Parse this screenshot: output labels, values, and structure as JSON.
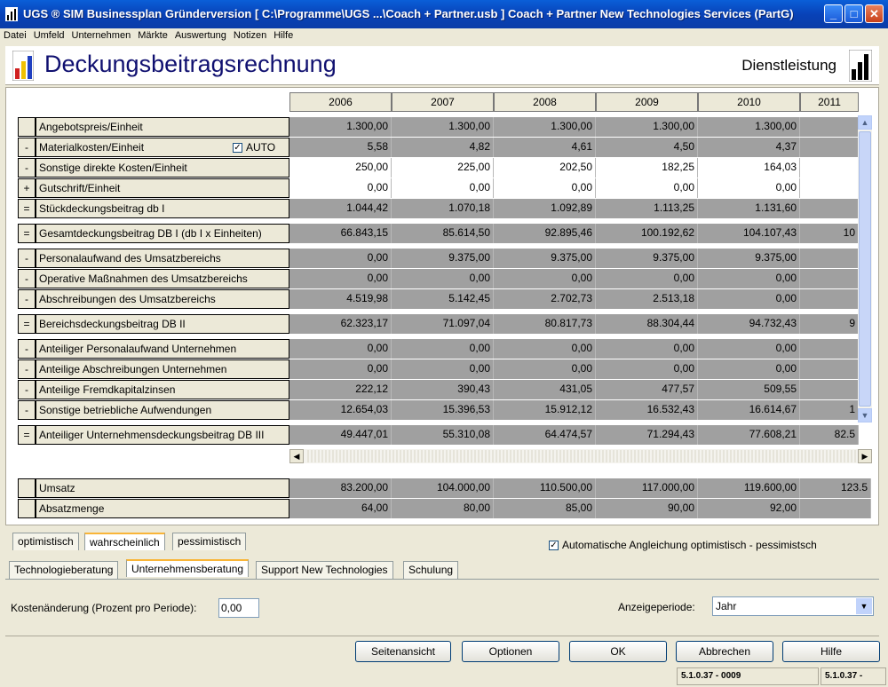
{
  "window": {
    "title": "UGS ® SIM Businessplan Gründerversion   [ C:\\Programme\\UGS ...\\Coach + Partner.usb ] Coach + Partner New Technologies Services (PartG)"
  },
  "menu": [
    "Datei",
    "Umfeld",
    "Unternehmen",
    "Märkte",
    "Auswertung",
    "Notizen",
    "Hilfe"
  ],
  "header": {
    "title": "Deckungsbeitragsrechnung",
    "category": "Dienstleistung"
  },
  "years": [
    "2006",
    "2007",
    "2008",
    "2009",
    "2010",
    "2011"
  ],
  "auto_label": "AUTO",
  "rows": [
    {
      "mark": "",
      "label": "Angebotspreis/Einheit",
      "style": "g",
      "values": [
        "1.300,00",
        "1.300,00",
        "1.300,00",
        "1.300,00",
        "1.300,00",
        ""
      ]
    },
    {
      "mark": "-",
      "label": "Materialkosten/Einheit",
      "style": "g",
      "values": [
        "5,58",
        "4,82",
        "4,61",
        "4,50",
        "4,37",
        ""
      ]
    },
    {
      "mark": "-",
      "label": "Sonstige direkte Kosten/Einheit",
      "style": "w",
      "values": [
        "250,00",
        "225,00",
        "202,50",
        "182,25",
        "164,03",
        ""
      ]
    },
    {
      "mark": "+",
      "label": "Gutschrift/Einheit",
      "style": "w",
      "values": [
        "0,00",
        "0,00",
        "0,00",
        "0,00",
        "0,00",
        ""
      ]
    },
    {
      "mark": "=",
      "label": "Stückdeckungsbeitrag db I",
      "style": "g",
      "values": [
        "1.044,42",
        "1.070,18",
        "1.092,89",
        "1.113,25",
        "1.131,60",
        ""
      ]
    },
    {
      "mark": "=",
      "label": "Gesamtdeckungsbeitrag DB I (db I x Einheiten)",
      "style": "g",
      "values": [
        "66.843,15",
        "85.614,50",
        "92.895,46",
        "100.192,62",
        "104.107,43",
        "10"
      ]
    },
    {
      "mark": "-",
      "label": "Personalaufwand des Umsatzbereichs",
      "style": "g",
      "values": [
        "0,00",
        "9.375,00",
        "9.375,00",
        "9.375,00",
        "9.375,00",
        ""
      ]
    },
    {
      "mark": "-",
      "label": "Operative Maßnahmen des Umsatzbereichs",
      "style": "g",
      "values": [
        "0,00",
        "0,00",
        "0,00",
        "0,00",
        "0,00",
        ""
      ]
    },
    {
      "mark": "-",
      "label": "Abschreibungen des Umsatzbereichs",
      "style": "g",
      "values": [
        "4.519,98",
        "5.142,45",
        "2.702,73",
        "2.513,18",
        "0,00",
        ""
      ]
    },
    {
      "mark": "=",
      "label": "Bereichsdeckungsbeitrag DB II",
      "style": "g",
      "values": [
        "62.323,17",
        "71.097,04",
        "80.817,73",
        "88.304,44",
        "94.732,43",
        "9"
      ]
    },
    {
      "mark": "-",
      "label": "Anteiliger Personalaufwand Unternehmen",
      "style": "g",
      "values": [
        "0,00",
        "0,00",
        "0,00",
        "0,00",
        "0,00",
        ""
      ]
    },
    {
      "mark": "-",
      "label": "Anteilige Abschreibungen Unternehmen",
      "style": "g",
      "values": [
        "0,00",
        "0,00",
        "0,00",
        "0,00",
        "0,00",
        ""
      ]
    },
    {
      "mark": "-",
      "label": "Anteilige Fremdkapitalzinsen",
      "style": "g",
      "values": [
        "222,12",
        "390,43",
        "431,05",
        "477,57",
        "509,55",
        ""
      ]
    },
    {
      "mark": "-",
      "label": "Sonstige betriebliche Aufwendungen",
      "style": "g",
      "values": [
        "12.654,03",
        "15.396,53",
        "15.912,12",
        "16.532,43",
        "16.614,67",
        "1"
      ]
    },
    {
      "mark": "=",
      "label": "Anteiliger Unternehmensdeckungsbeitrag DB III",
      "style": "g",
      "values": [
        "49.447,01",
        "55.310,08",
        "64.474,57",
        "71.294,43",
        "77.608,21",
        "82.5"
      ]
    }
  ],
  "summary_rows": [
    {
      "mark": "",
      "label": "Umsatz",
      "values": [
        "83.200,00",
        "104.000,00",
        "110.500,00",
        "117.000,00",
        "119.600,00",
        "123.5"
      ]
    },
    {
      "mark": "",
      "label": "Absatzmenge",
      "values": [
        "64,00",
        "80,00",
        "85,00",
        "90,00",
        "92,00",
        ""
      ]
    }
  ],
  "scenario_tabs": [
    "optimistisch",
    "wahrscheinlich",
    "pessimistisch"
  ],
  "auto_adjust_label": "Automatische Angleichung optimistisch - pessimistsch",
  "product_tabs": [
    "Technologieberatung",
    "Unternehmensberatung",
    "Support New Technologies",
    "Schulung"
  ],
  "kosten_label": "Kostenänderung (Prozent pro Periode):",
  "kosten_value": "0,00",
  "anzeige_label": "Anzeigeperiode:",
  "anzeige_value": "Jahr",
  "buttons": {
    "seitenansicht": "Seitenansicht",
    "optionen": "Optionen",
    "ok": "OK",
    "abbrechen": "Abbrechen",
    "hilfe": "Hilfe"
  },
  "status": [
    "5.1.0.37 - 0009",
    "5.1.0.37 -"
  ]
}
